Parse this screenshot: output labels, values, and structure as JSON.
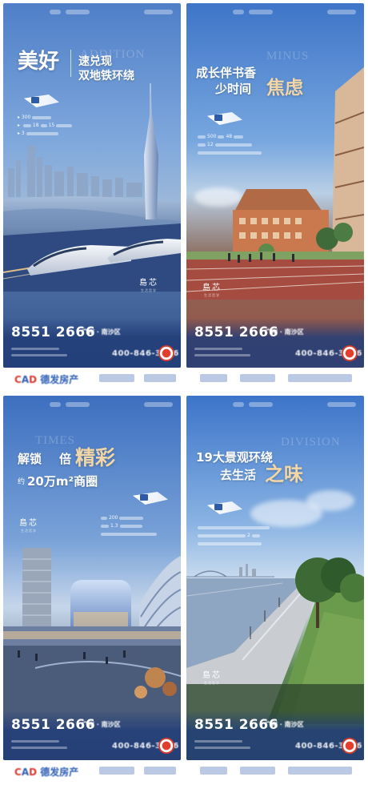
{
  "posters": [
    {
      "headline_big": "美好",
      "headline_line1": "速兑现",
      "headline_line2": "双地铁环绕",
      "ghost_word": "ADDITION",
      "info_lines": [
        "300",
        "18",
        "15",
        "3"
      ],
      "brand_cn": "島芯",
      "brand_sub": "生活哲学",
      "phone_main": "8551 2666",
      "phone_tag": "广州 · 南沙区",
      "phone_sub": "400-846-3636"
    },
    {
      "headline_line1": "成长伴书香",
      "headline_line2": "少时间",
      "headline_gold": "焦虑",
      "ghost_word": "MINUS",
      "info_lines": [
        "500",
        "48",
        "12"
      ],
      "brand_cn": "島芯",
      "brand_sub": "生活哲学",
      "phone_main": "8551 2666",
      "phone_tag": "广州 · 南沙区",
      "phone_sub": "400-846-3636"
    },
    {
      "headline_part1": "解锁",
      "headline_part2": "倍",
      "headline_gold": "精彩",
      "headline_line2_prefix": "约",
      "headline_line2": "20万m²商圈",
      "ghost_word": "TIMES",
      "info_lines": [
        "200",
        "1.3"
      ],
      "brand_cn": "島芯",
      "brand_sub": "生活哲学",
      "phone_main": "8551 2666",
      "phone_tag": "广州 · 南沙区",
      "phone_sub": "400-846-3636"
    },
    {
      "headline_line1": "19大景观环绕",
      "headline_line2": "去生活",
      "headline_gold": "之味",
      "ghost_word": "DIVISION",
      "info_lines": [
        "2"
      ],
      "brand_cn": "島芯",
      "brand_sub": "生活哲学",
      "phone_main": "8551 2666",
      "phone_tag": "广州 · 南沙区",
      "phone_sub": "400-846-3636"
    }
  ],
  "footer_brand": {
    "logo_prefix": "C",
    "logo_a": "A",
    "logo_d": "D",
    "name": "德发房产"
  },
  "colors": {
    "gold": "#f3d6a6",
    "brand_blue": "#2f5fb6",
    "brand_red": "#d93a31"
  }
}
